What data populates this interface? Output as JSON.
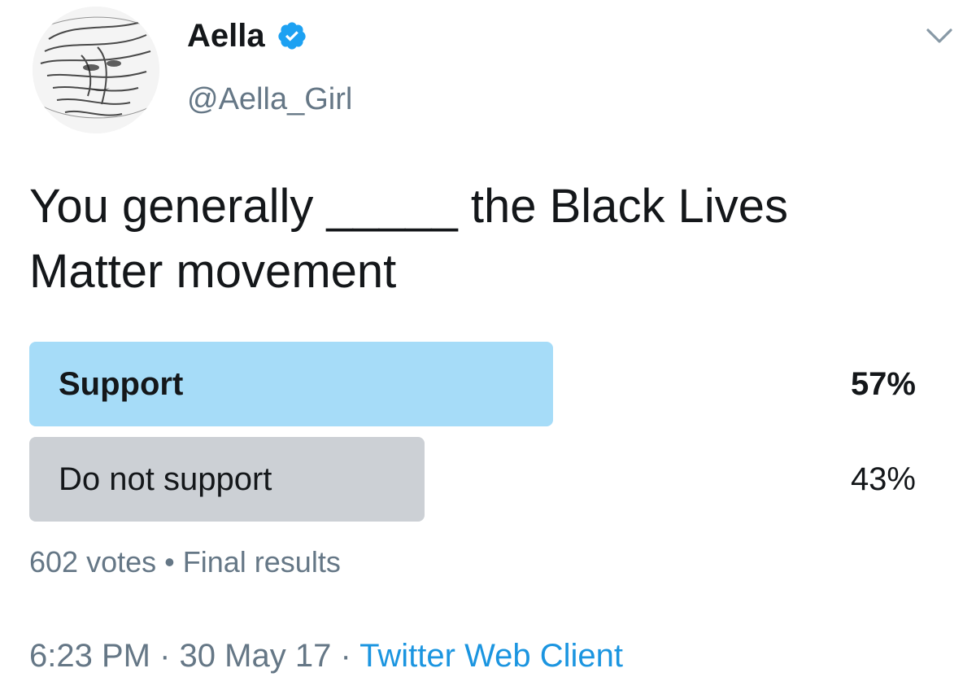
{
  "author": {
    "display_name": "Aella",
    "handle": "@Aella_Girl",
    "verified": true,
    "avatar_icon": "sketch-portrait-avatar",
    "verified_color": "#1da1f2"
  },
  "tweet": {
    "text": "You generally _____ the Black Lives Matter movement"
  },
  "poll": {
    "options": [
      {
        "label": "Support",
        "percent_text": "57%",
        "fraction": 0.57,
        "winner": true
      },
      {
        "label": "Do not support",
        "percent_text": "43%",
        "fraction": 0.43,
        "winner": false
      }
    ],
    "votes_text": "602 votes",
    "separator": "•",
    "status_text": "Final results",
    "winner_color": "#a6dcf8",
    "other_color": "#ccd0d5"
  },
  "meta": {
    "time": "6:23 PM",
    "date": "30 May 17",
    "dot": "·",
    "source": "Twitter Web Client",
    "link_color": "#1b95e0"
  },
  "menu": {
    "caret_icon": "chevron-down-icon"
  }
}
